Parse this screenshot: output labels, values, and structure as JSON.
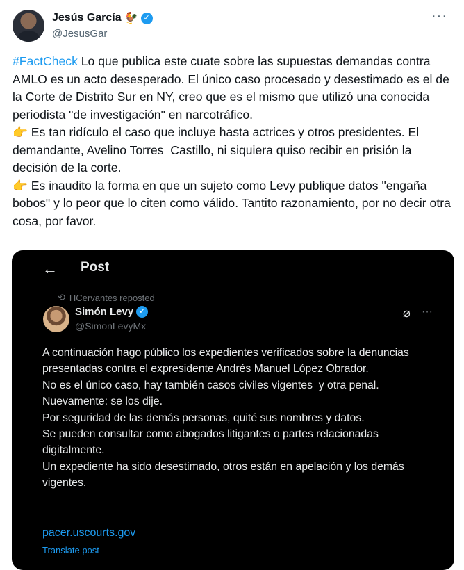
{
  "author": {
    "name": "Jesús García",
    "flag_emoji": "🐓",
    "handle": "@JesusGar",
    "verified": true
  },
  "tweet": {
    "hashtag": "#FactCheck",
    "body": " Lo que publica este cuate sobre las supuestas demandas contra AMLO es un acto desesperado. El único caso procesado y desestimado es el de la Corte de Distrito Sur en NY, creo que es el mismo que utilizó una conocida periodista \"de investigación\" en narcotráfico.\n👉 Es tan ridículo el caso que incluye hasta actrices y otros presidentes. El demandante, Avelino Torres  Castillo, ni siquiera quiso recibir en prisión la decisión de la corte.\n👉 Es inaudito la forma en que un sujeto como Levy publique datos \"engaña bobos\" y lo peor que lo citen como válido. Tantito razonamiento, por no decir otra cosa, por favor."
  },
  "media": {
    "header_title": "Post",
    "repost_label": "HCervantes reposted",
    "inner_author": {
      "name": "Simón Levy",
      "handle": "@SimonLevyMx"
    },
    "inner_text": "A continuación hago público los expedientes verificados sobre la denuncias presentadas contra el expresidente Andrés Manuel López Obrador.\nNo es el único caso, hay también casos civiles vigentes  y otra penal.\nNuevamente: se los dije.\nPor seguridad de las demás personas, quité sus nombres y datos.\nSe pueden consultar como abogados litigantes o partes relacionadas digitalmente.\nUn expediente ha sido desestimado, otros están en apelación y los demás vigentes.",
    "link": "pacer.uscourts.gov",
    "translate": "Translate post"
  }
}
